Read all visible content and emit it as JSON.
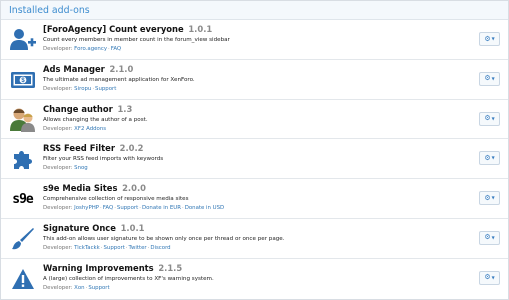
{
  "header": {
    "title": "Installed add-ons"
  },
  "addons": [
    {
      "icon": "add-user-icon",
      "title": "[ForoAgency] Count everyone",
      "version": "1.0.1",
      "description": "Count every members in member count in the forum_view sidebar",
      "developer_label": "Developer:",
      "links": [
        "Foro.agency",
        "FAQ"
      ]
    },
    {
      "icon": "banknote-icon",
      "title": "Ads Manager",
      "version": "2.1.0",
      "description": "The ultimate ad management application for XenForo.",
      "developer_label": "Developer:",
      "links": [
        "Siropu",
        "Support"
      ]
    },
    {
      "icon": "users-avatar-icon",
      "title": "Change author",
      "version": "1.3",
      "description": "Allows changing the author of a post.",
      "developer_label": "Developer:",
      "links": [
        "XF2 Addons"
      ]
    },
    {
      "icon": "puzzle-piece-icon",
      "title": "RSS Feed Filter",
      "version": "2.0.2",
      "description": "Filter your RSS feed imports with keywords",
      "developer_label": "Developer:",
      "links": [
        "Snog"
      ]
    },
    {
      "icon": "s9e-logo-icon",
      "icon_text": "s9e",
      "title": "s9e Media Sites",
      "version": "2.0.0",
      "description": "Comprehensive collection of responsive media sites",
      "developer_label": "Developer:",
      "links": [
        "JoshyPHP",
        "FAQ",
        "Support",
        "Donate in EUR",
        "Donate in USD"
      ]
    },
    {
      "icon": "paintbrush-icon",
      "title": "Signature Once",
      "version": "1.0.1",
      "description": "This add-on allows user signature to be shown only once per thread or once per page.",
      "developer_label": "Developer:",
      "links": [
        "TickTackk",
        "Support",
        "Twitter",
        "Discord"
      ]
    },
    {
      "icon": "warning-triangle-icon",
      "title": "Warning Improvements",
      "version": "2.1.5",
      "description": "A (large) collection of improvements to XF's warning system.",
      "developer_label": "Developer:",
      "links": [
        "Xon",
        "Support"
      ]
    }
  ],
  "colors": {
    "accent": "#3e8dcf",
    "link": "#3177b5",
    "icon_blue": "#2f6fb2"
  }
}
